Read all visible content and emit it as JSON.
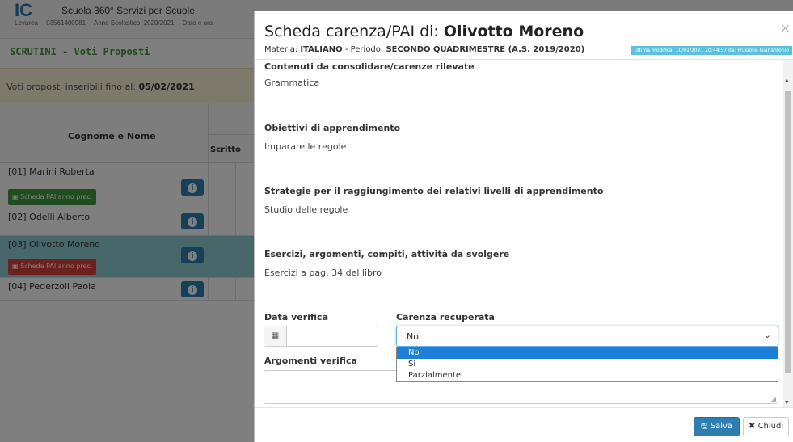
{
  "background": {
    "logo": "IC",
    "school_name": "Scuola 360° Servizi per Scuole",
    "school_sub_left": "Levarea",
    "school_code": "03561400981",
    "school_year": "Anno Scolastico: 2020/2021",
    "school_extra": "Dato e ora",
    "section_title": "SCRUTINI - Voti Proposti",
    "notice_prefix": "Voti proposti inseribili fino al:",
    "notice_date": "05/02/2021",
    "col_name": "Cognome e Nome",
    "col_scritto": "Scritto",
    "students": [
      {
        "name": "[01] Marini Roberta",
        "pai_label": "Scheda PAI anno prec.",
        "pai_color": "#3f9a3f"
      },
      {
        "name": "[02] Odelli Alberto"
      },
      {
        "name": "[03] Olivotto Moreno",
        "pai_label": "Scheda PAI anno prec.",
        "pai_color": "#d9423a"
      },
      {
        "name": "[04] Pederzoli Paola"
      }
    ],
    "info_icon": "info-icon"
  },
  "modal": {
    "title_prefix": "Scheda carenza/PAI di:",
    "title_name": "Olivotto Moreno",
    "materia_label": "Materia:",
    "materia_value": "ITALIANO",
    "periodo_label": "- Periodo:",
    "periodo_value": "SECONDO QUADRIMESTRE (A.S. 2019/2020)",
    "last_modified": "Ultima modifica: 10/01/2021 20:44:57 da: Frusione Gianantonio",
    "close_symbol": "×",
    "fields": [
      {
        "label": "Contenuti da consolidare/carenze rilevate",
        "value": "Grammatica"
      },
      {
        "label": "Obiettivi di apprendimento",
        "value": "Imparare le regole"
      },
      {
        "label": "Strategie per il raggiungimento dei relativi livelli di apprendimento",
        "value": "Studio delle regole"
      },
      {
        "label": "Esercizi, argomenti, compiti, attività da svolgere",
        "value": "Esercizi a pag. 34 del libro"
      }
    ],
    "data_verifica_label": "Data verifica",
    "data_verifica_value": "",
    "calendar_icon": "calendar-icon",
    "carenza_label": "Carenza recuperata",
    "carenza_selected": "No",
    "carenza_options": [
      "No",
      "Sì",
      "Parzialmente"
    ],
    "argomenti_label": "Argomenti verifica",
    "argomenti_value": "",
    "save_label": "Salva",
    "close_label": "Chiudi"
  },
  "colors": {
    "primary": "#2c7fb0",
    "info_badge": "#5bc0de",
    "highlight_row": "#8fcfd4",
    "dropdown_selected": "#1e7fd8"
  }
}
